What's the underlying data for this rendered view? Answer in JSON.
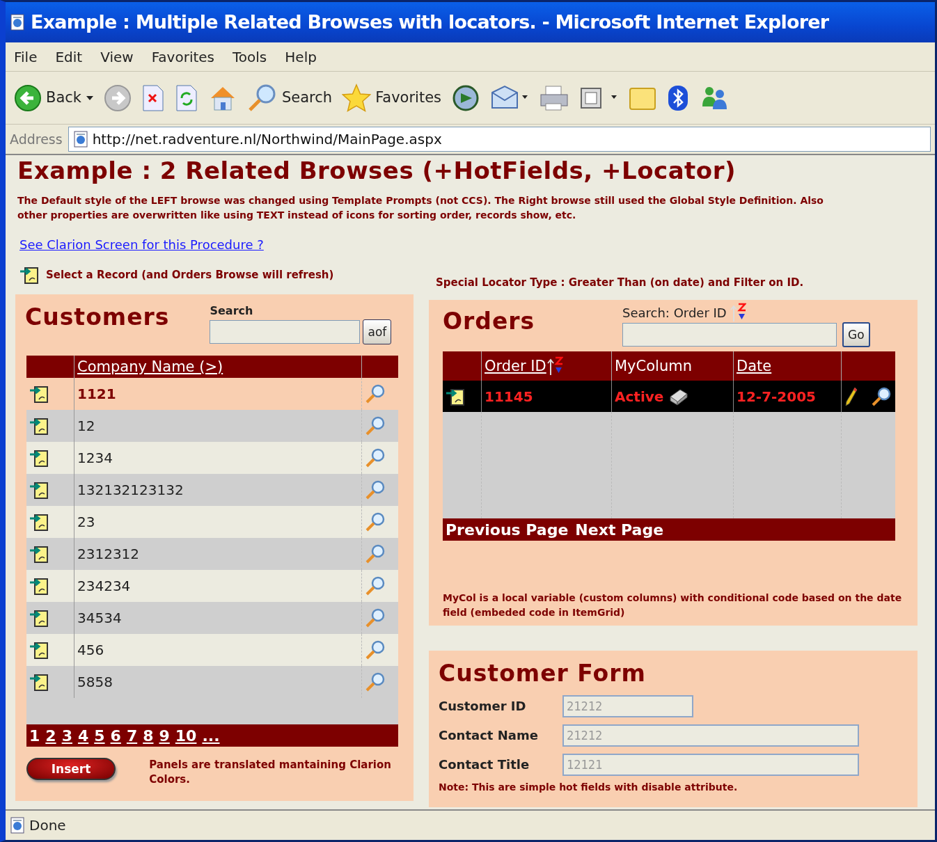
{
  "window": {
    "title": "Example : Multiple Related Browses with locators. - Microsoft Internet Explorer"
  },
  "menu": [
    "File",
    "Edit",
    "View",
    "Favorites",
    "Tools",
    "Help"
  ],
  "toolbar": [
    {
      "kind": "back",
      "label": "Back"
    },
    {
      "kind": "forward"
    },
    {
      "kind": "stop"
    },
    {
      "kind": "refresh"
    },
    {
      "kind": "home"
    },
    {
      "kind": "search",
      "label": "Search"
    },
    {
      "kind": "favorites",
      "label": "Favorites"
    },
    {
      "kind": "media"
    },
    {
      "kind": "mail"
    },
    {
      "kind": "print"
    },
    {
      "kind": "edit"
    },
    {
      "kind": "folder"
    },
    {
      "kind": "bluetooth"
    },
    {
      "kind": "messenger"
    }
  ],
  "address": {
    "label": "Address",
    "url": "http://net.radventure.nl/Northwind/MainPage.aspx"
  },
  "page": {
    "heading": "Example : 2 Related Browses (+HotFields, +Locator)",
    "description": "The Default style of the LEFT browse was changed using Template Prompts (not CCS). The Right browse still used the Global Style Definition. Also other properties are overwritten like using TEXT instead of icons for sorting order, records show, etc.",
    "link": "See Clarion Screen for this Procedure ?",
    "left_hint": "Select a Record (and Orders Browse will refresh)",
    "right_hint": "Special Locator Type : Greater Than (on date) and Filter on ID."
  },
  "customers": {
    "title": "Customers",
    "search_label": "Search",
    "search_button": "aof",
    "column": "Company Name (>)",
    "rows": [
      {
        "name": "1121",
        "selected": true
      },
      {
        "name": "12",
        "selected": false
      },
      {
        "name": "1234",
        "selected": false
      },
      {
        "name": "132132123132",
        "selected": false
      },
      {
        "name": "23",
        "selected": false
      },
      {
        "name": "2312312",
        "selected": false
      },
      {
        "name": "234234",
        "selected": false
      },
      {
        "name": "34534",
        "selected": false
      },
      {
        "name": "456",
        "selected": false
      },
      {
        "name": "5858",
        "selected": false
      }
    ],
    "pages": [
      {
        "label": "1",
        "selected": true
      },
      {
        "label": "2",
        "selected": false
      },
      {
        "label": "3",
        "selected": false
      },
      {
        "label": "4",
        "selected": false
      },
      {
        "label": "5",
        "selected": false
      },
      {
        "label": "6",
        "selected": false
      },
      {
        "label": "7",
        "selected": false
      },
      {
        "label": "8",
        "selected": false
      },
      {
        "label": "9",
        "selected": false
      },
      {
        "label": "10",
        "selected": false
      },
      {
        "label": "...",
        "selected": false
      }
    ],
    "insert_button": "Insert",
    "note": "Panels are translated mantaining Clarion Colors."
  },
  "orders": {
    "title": "Orders",
    "search_label": "Search: Order ID",
    "search_button": "Go",
    "columns": [
      "Order ID",
      "MyColumn",
      "Date"
    ],
    "rows": [
      {
        "order_id": "11145",
        "mycolumn": "Active",
        "date": "12-7-2005",
        "selected": true
      }
    ],
    "pager": [
      "Previous Page",
      "Next Page"
    ],
    "note": "MyCol is a local variable (custom columns) with conditional code based on the date field (embeded code in ItemGrid)"
  },
  "customer_form": {
    "title": "Customer Form",
    "fields": [
      {
        "label": "Customer ID",
        "value": "21212",
        "disabled": true
      },
      {
        "label": "Contact Name",
        "value": "21212",
        "disabled": true
      },
      {
        "label": "Contact Title",
        "value": "12121",
        "disabled": true
      }
    ],
    "note": "Note: This are simple hot fields with disable attribute."
  },
  "status_bar": {
    "text": "Done"
  }
}
